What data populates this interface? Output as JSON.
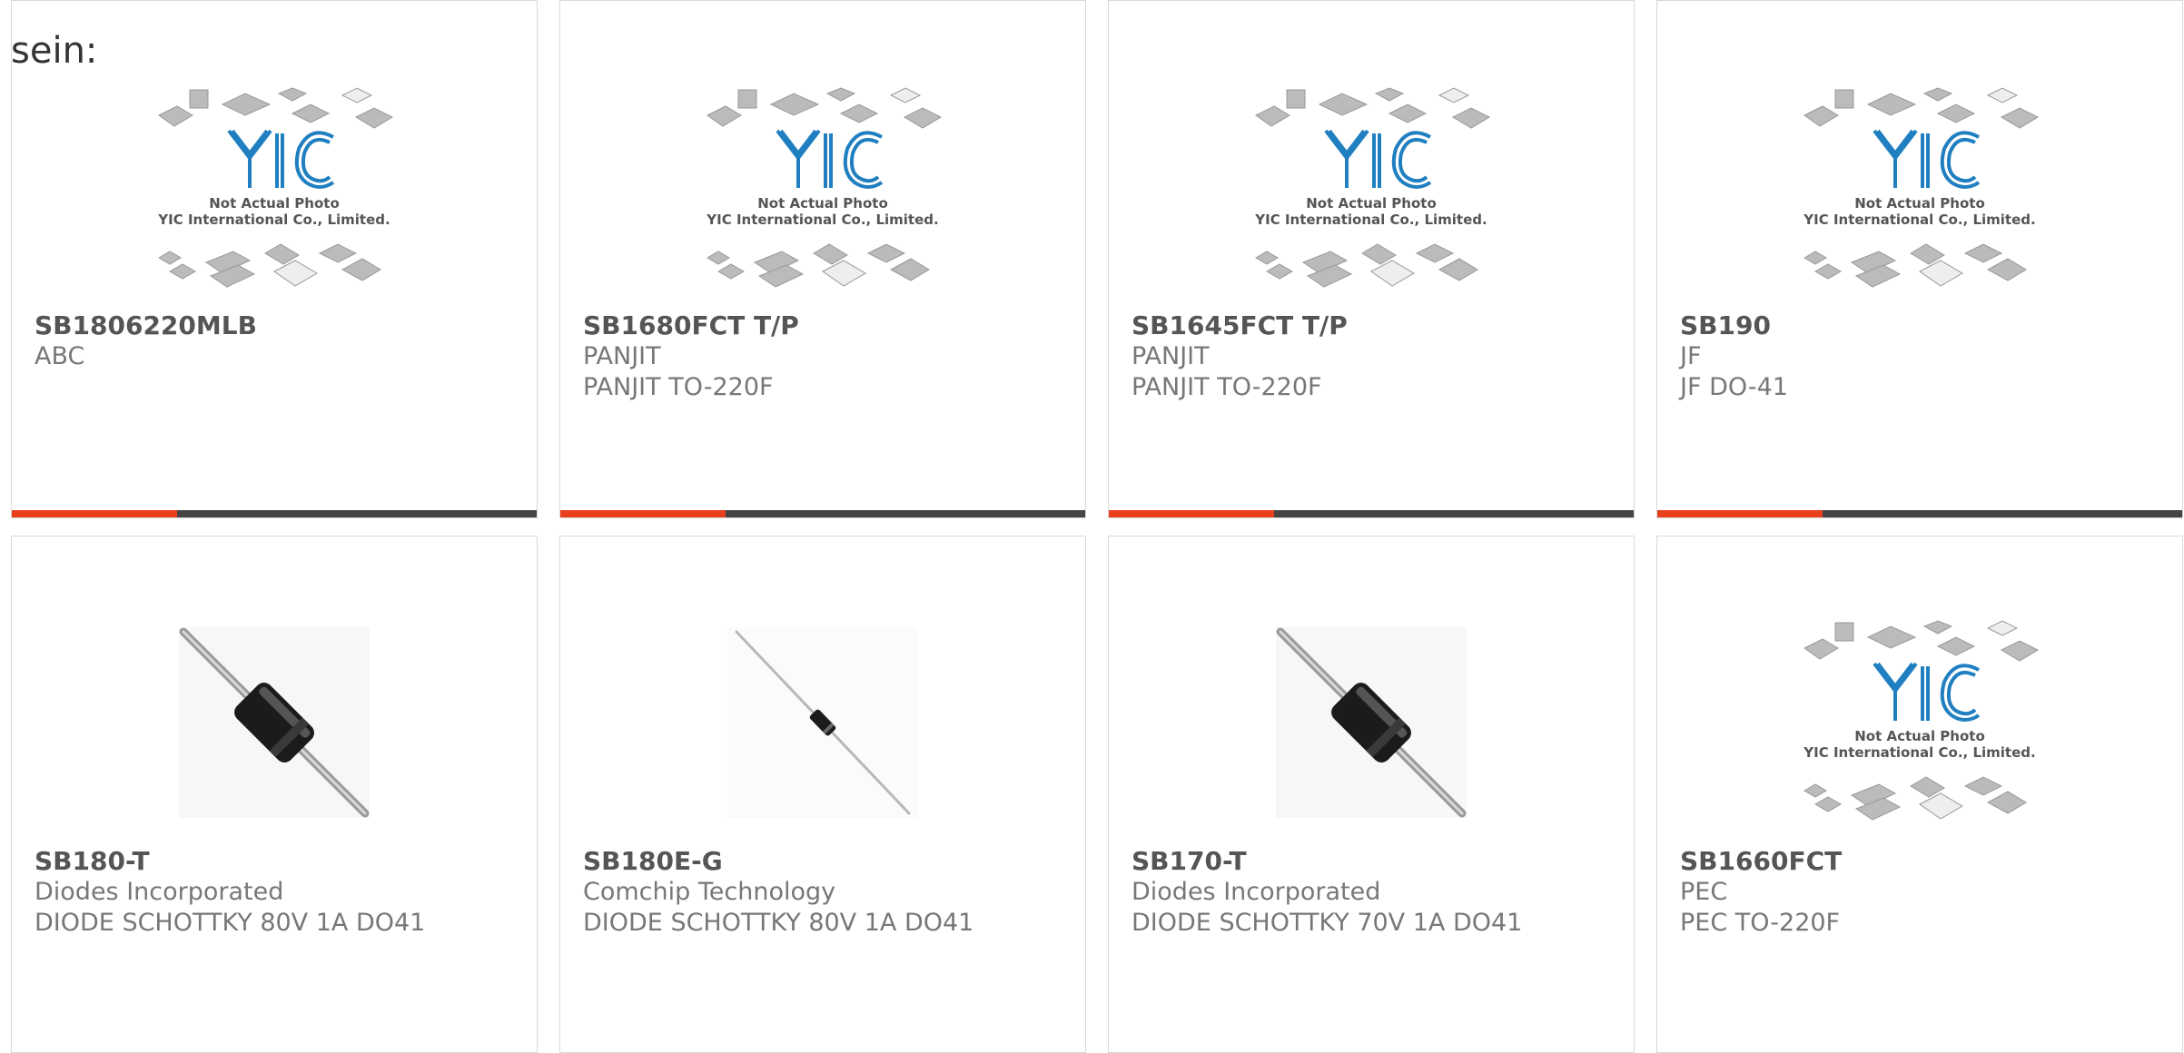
{
  "heading": "sein:",
  "placeholder": {
    "line1": "Not Actual Photo",
    "line2": "YIC International Co., Limited.",
    "logo_text": "YIC"
  },
  "colors": {
    "accent": "#e8401c",
    "bar": "#444444",
    "logo": "#1f7fc0"
  },
  "products": [
    {
      "part": "SB1806220MLB",
      "manufacturer": "ABC",
      "description": "",
      "image": "placeholder"
    },
    {
      "part": "SB1680FCT T/P",
      "manufacturer": "PANJIT",
      "description": "PANJIT TO-220F",
      "image": "placeholder"
    },
    {
      "part": "SB1645FCT T/P",
      "manufacturer": "PANJIT",
      "description": "PANJIT TO-220F",
      "image": "placeholder"
    },
    {
      "part": "SB190",
      "manufacturer": "JF",
      "description": "JF DO-41",
      "image": "placeholder"
    },
    {
      "part": "SB180-T",
      "manufacturer": "Diodes Incorporated",
      "description": "DIODE SCHOTTKY 80V 1A DO41",
      "image": "diode-large"
    },
    {
      "part": "SB180E-G",
      "manufacturer": "Comchip Technology",
      "description": "DIODE SCHOTTKY 80V 1A DO41",
      "image": "diode-small"
    },
    {
      "part": "SB170-T",
      "manufacturer": "Diodes Incorporated",
      "description": "DIODE SCHOTTKY 70V 1A DO41",
      "image": "diode-large"
    },
    {
      "part": "SB1660FCT",
      "manufacturer": "PEC",
      "description": "PEC TO-220F",
      "image": "placeholder"
    }
  ]
}
